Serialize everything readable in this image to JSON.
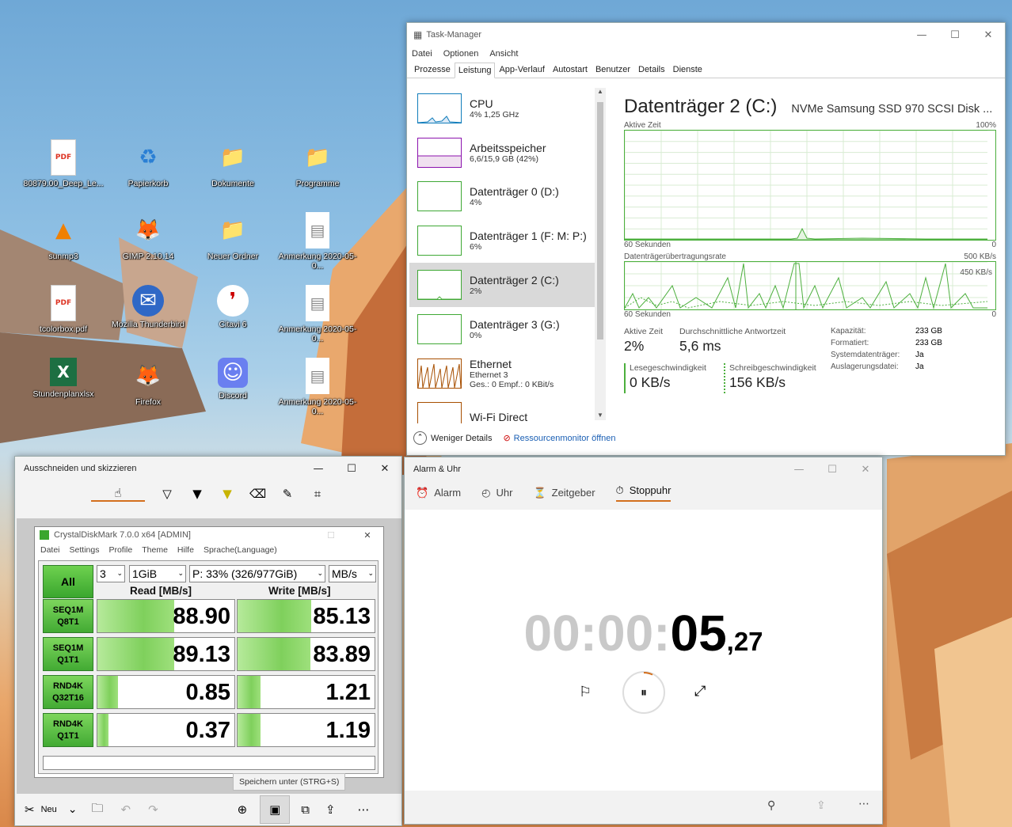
{
  "desktop": {
    "icons": [
      {
        "label": "80879.00_Deep_Le...",
        "icon": "pdf-icon",
        "glyph": "PDF"
      },
      {
        "label": "Papierkorb",
        "icon": "recycle-bin-icon",
        "glyph": "♻"
      },
      {
        "label": "Dokumente",
        "icon": "folder-icon",
        "glyph": "📁"
      },
      {
        "label": "Programme",
        "icon": "folder-icon",
        "glyph": "📁"
      },
      {
        "label": "sunmp3",
        "icon": "vlc-icon",
        "glyph": "▲"
      },
      {
        "label": "GIMP 2.10.14",
        "icon": "gimp-icon",
        "glyph": "🦊"
      },
      {
        "label": "Neuer Ordner",
        "icon": "folder-icon",
        "glyph": "📁"
      },
      {
        "label": "Anmerkung 2020-05-0...",
        "icon": "image-file-icon",
        "glyph": "▤"
      },
      {
        "label": "tcolorbox.pdf",
        "icon": "pdf-icon",
        "glyph": "PDF"
      },
      {
        "label": "Mozilla Thunderbird",
        "icon": "thunderbird-icon",
        "glyph": "✉"
      },
      {
        "label": "Citavi 6",
        "icon": "citavi-icon",
        "glyph": "❜"
      },
      {
        "label": "Anmerkung 2020-05-0...",
        "icon": "image-file-icon",
        "glyph": "▤"
      },
      {
        "label": "Stundenplanxlsx",
        "icon": "excel-icon",
        "glyph": "X"
      },
      {
        "label": "Firefox",
        "icon": "firefox-icon",
        "glyph": "🦊"
      },
      {
        "label": "Discord",
        "icon": "discord-icon",
        "glyph": "☺"
      },
      {
        "label": "Anmerkung 2020-05-0...",
        "icon": "image-file-icon",
        "glyph": "▤"
      }
    ]
  },
  "taskmanager": {
    "title": "Task-Manager",
    "menu": [
      "Datei",
      "Optionen",
      "Ansicht"
    ],
    "tabs": [
      "Prozesse",
      "Leistung",
      "App-Verlauf",
      "Autostart",
      "Benutzer",
      "Details",
      "Dienste"
    ],
    "active_tab": "Leistung",
    "items": [
      {
        "t1": "CPU",
        "t2": "4% 1,25 GHz",
        "t3": ""
      },
      {
        "t1": "Arbeitsspeicher",
        "t2": "6,6/15,9 GB (42%)",
        "t3": ""
      },
      {
        "t1": "Datenträger 0 (D:)",
        "t2": "4%",
        "t3": ""
      },
      {
        "t1": "Datenträger 1 (F: M: P:)",
        "t2": "6%",
        "t3": ""
      },
      {
        "t1": "Datenträger 2 (C:)",
        "t2": "2%",
        "t3": ""
      },
      {
        "t1": "Datenträger 3 (G:)",
        "t2": "0%",
        "t3": ""
      },
      {
        "t1": "Ethernet",
        "t2": "Ethernet 3",
        "t3": "Ges.: 0 Empf.: 0 KBit/s"
      },
      {
        "t1": "Wi-Fi Direct",
        "t2": "",
        "t3": ""
      }
    ],
    "detail": {
      "title": "Datenträger 2 (C:)",
      "model": "NVMe Samsung SSD 970 SCSI Disk ...",
      "g1_label": "Aktive Zeit",
      "g1_max": "100%",
      "g1_left": "60 Sekunden",
      "g1_right": "0",
      "g2_label": "Datenträgerübertragungsrate",
      "g2_max": "500 KB/s",
      "g2_mark": "450 KB/s",
      "g2_left": "60 Sekunden",
      "g2_right": "0",
      "active_label": "Aktive Zeit",
      "active_val": "2%",
      "resp_label": "Durchschnittliche Antwortzeit",
      "resp_val": "5,6 ms",
      "read_label": "Lesegeschwindigkeit",
      "read_val": "0 KB/s",
      "write_label": "Schreibgeschwindigkeit",
      "write_val": "156 KB/s",
      "props": [
        {
          "k": "Kapazität:",
          "v": "233 GB"
        },
        {
          "k": "Formatiert:",
          "v": "233 GB"
        },
        {
          "k": "Systemdatenträger:",
          "v": "Ja"
        },
        {
          "k": "Auslagerungsdatei:",
          "v": "Ja"
        }
      ]
    },
    "less": "Weniger Details",
    "resmon": "Ressourcenmonitor öffnen"
  },
  "snip": {
    "title": "Ausschneiden und skizzieren",
    "tooltip": "Speichern unter (STRG+S)",
    "new_label": "Neu",
    "cdm": {
      "title": "CrystalDiskMark 7.0.0 x64 [ADMIN]",
      "menu": [
        "Datei",
        "Settings",
        "Profile",
        "Theme",
        "Hilfe",
        "Sprache(Language)"
      ],
      "all": "All",
      "count": "3",
      "size": "1GiB",
      "drive": "P: 33% (326/977GiB)",
      "unit": "MB/s",
      "read_hdr": "Read [MB/s]",
      "write_hdr": "Write [MB/s]",
      "rows": [
        {
          "l1": "SEQ1M",
          "l2": "Q8T1",
          "read": "88.90",
          "write": "85.13",
          "rf": 0.56,
          "wf": 0.54
        },
        {
          "l1": "SEQ1M",
          "l2": "Q1T1",
          "read": "89.13",
          "write": "83.89",
          "rf": 0.56,
          "wf": 0.53
        },
        {
          "l1": "RND4K",
          "l2": "Q32T16",
          "read": "0.85",
          "write": "1.21",
          "rf": 0.15,
          "wf": 0.17
        },
        {
          "l1": "RND4K",
          "l2": "Q1T1",
          "read": "0.37",
          "write": "1.19",
          "rf": 0.08,
          "wf": 0.17
        }
      ]
    }
  },
  "alarm": {
    "title": "Alarm & Uhr",
    "tabs": [
      "Alarm",
      "Uhr",
      "Zeitgeber",
      "Stoppuhr"
    ],
    "active": "Stoppuhr",
    "time_dim": "00:00:",
    "time_main": "05",
    "time_small": ",27"
  }
}
